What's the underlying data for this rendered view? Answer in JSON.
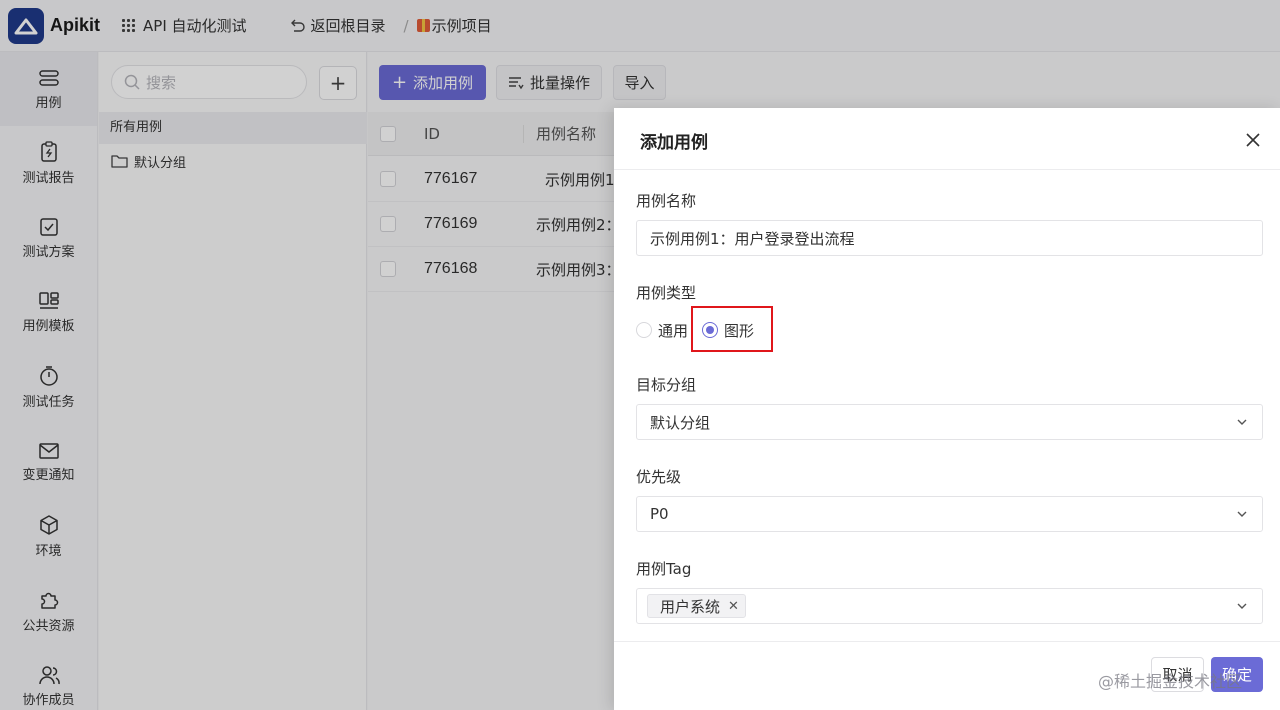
{
  "app": {
    "name": "Apikit",
    "project": "API 自动化测试",
    "back_label": "返回根目录",
    "breadcrumb": "示例项目"
  },
  "nav": [
    {
      "label": "用例",
      "icon": "sliders-icon"
    },
    {
      "label": "测试报告",
      "icon": "report-icon"
    },
    {
      "label": "测试方案",
      "icon": "checklist-icon"
    },
    {
      "label": "用例模板",
      "icon": "template-icon"
    },
    {
      "label": "测试任务",
      "icon": "timer-icon"
    },
    {
      "label": "变更通知",
      "icon": "mail-icon"
    },
    {
      "label": "环境",
      "icon": "cube-icon"
    },
    {
      "label": "公共资源",
      "icon": "puzzle-icon"
    },
    {
      "label": "协作成员",
      "icon": "members-icon"
    }
  ],
  "tree": {
    "search_placeholder": "搜索",
    "add_label": "+",
    "all_cases": "所有用例",
    "default_group": "默认分组"
  },
  "toolbar": {
    "add_case": "添加用例",
    "batch": "批量操作",
    "import": "导入"
  },
  "table": {
    "columns": [
      "ID",
      "用例名称"
    ],
    "rows": [
      {
        "id": "776167",
        "name": "示例用例1"
      },
      {
        "id": "776169",
        "name": "示例用例2："
      },
      {
        "id": "776168",
        "name": "示例用例3："
      }
    ]
  },
  "modal": {
    "title": "添加用例",
    "name_label": "用例名称",
    "name_value": "示例用例1：用户登录登出流程",
    "type_label": "用例类型",
    "type_options": [
      "通用",
      "图形"
    ],
    "type_selected": "图形",
    "group_label": "目标分组",
    "group_value": "默认分组",
    "priority_label": "优先级",
    "priority_value": "P0",
    "tag_label": "用例Tag",
    "tag_value": "用户系统",
    "cancel": "取消",
    "ok": "确定"
  },
  "watermark": "@稀土掘金技术社区",
  "colors": {
    "accent": "#6b6bd6",
    "highlight": "#e0161b"
  }
}
